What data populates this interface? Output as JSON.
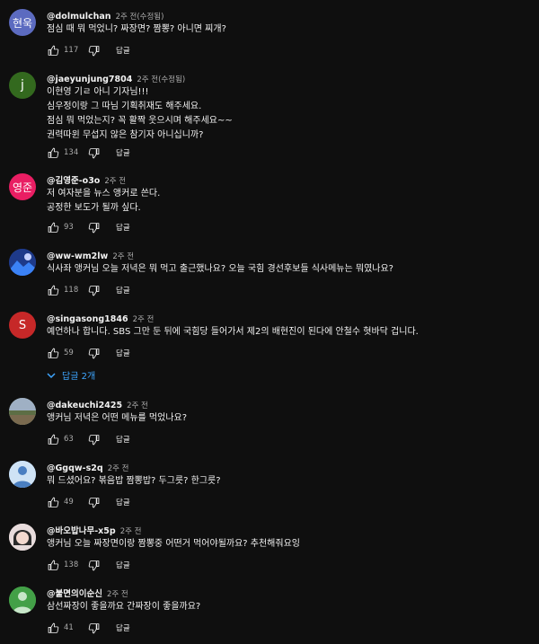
{
  "comments": [
    {
      "author": "@dolmulchan",
      "time": "2주 전(수정됨)",
      "avatar_text": "현욱",
      "avatar_color": "#5c6bc0",
      "lines": [
        "점심 때 뭐 먹었니? 짜장면? 짬뽕? 아니면 찌개?"
      ],
      "likes": "117",
      "reply_label": "답글"
    },
    {
      "author": "@jaeyunjung7804",
      "time": "2주 전(수정됨)",
      "avatar_text": "j",
      "avatar_color": "#33691e",
      "lines": [
        "이현영 기ㄹ 아니 기자님!!!",
        "심우정이랑 그 따님 기획취재도 해주세요.",
        "점심 뭐 먹었는지? 꼭 활짝 웃으시며 해주세요~~",
        "권력따윈 무섭지 않은 참기자 아니십니까?"
      ],
      "likes": "134",
      "reply_label": "답글"
    },
    {
      "author": "@김영준-o3o",
      "time": "2주 전",
      "avatar_text": "영준",
      "avatar_color": "#e91e63",
      "lines": [
        "저 여자분을 뉴스 앵커로 쓴다.",
        "공정한 보도가 될까 싶다."
      ],
      "likes": "93",
      "reply_label": "답글"
    },
    {
      "author": "@ww-wm2lw",
      "time": "2주 전",
      "avatar_text": "",
      "avatar_color": "#1e3a8a",
      "lines": [
        "식사좌 앵커님 오늘 저녁은 뭐 먹고 출근했나요? 오늘 국힘 경선후보들 식사메뉴는 뭐였나요?"
      ],
      "likes": "118",
      "reply_label": "답글"
    },
    {
      "author": "@singasong1846",
      "time": "2주 전",
      "avatar_text": "S",
      "avatar_color": "#c62828",
      "lines": [
        "예언하나 합니다. SBS 그만 둔 뒤에 국힘당 들어가서 제2의 배현진이 된다에 안철수 혓바닥 겁니다."
      ],
      "likes": "59",
      "reply_label": "답글",
      "replies_label": "답글 2개"
    },
    {
      "author": "@dakeuchi2425",
      "time": "2주 전",
      "avatar_text": "",
      "avatar_color": "#6b7f5e",
      "lines": [
        "앵커님 저녁은 어떤 메뉴를 먹었나요?"
      ],
      "likes": "63",
      "reply_label": "답글"
    },
    {
      "author": "@Ggqw-s2q",
      "time": "2주 전",
      "avatar_text": "",
      "avatar_color": "#4a7fc1",
      "lines": [
        "뭐 드셨어요? 볶음밥 짬뽕밥? 두그릇? 한그릇?"
      ],
      "likes": "49",
      "reply_label": "답글"
    },
    {
      "author": "@바오밥나무-x5p",
      "time": "2주 전",
      "avatar_text": "",
      "avatar_color": "#d9c6c8",
      "lines": [
        "앵커님 오늘 짜장면이랑 짬뽕중 어떤거 먹어야될까요? 추천해줘요잉"
      ],
      "likes": "138",
      "reply_label": "답글"
    },
    {
      "author": "@불면의이순신",
      "time": "2주 전",
      "avatar_text": "",
      "avatar_color": "#43a047",
      "lines": [
        "삼선짜장이 좋을까요 간짜장이 좋을까요?"
      ],
      "likes": "41",
      "reply_label": "답글"
    }
  ]
}
